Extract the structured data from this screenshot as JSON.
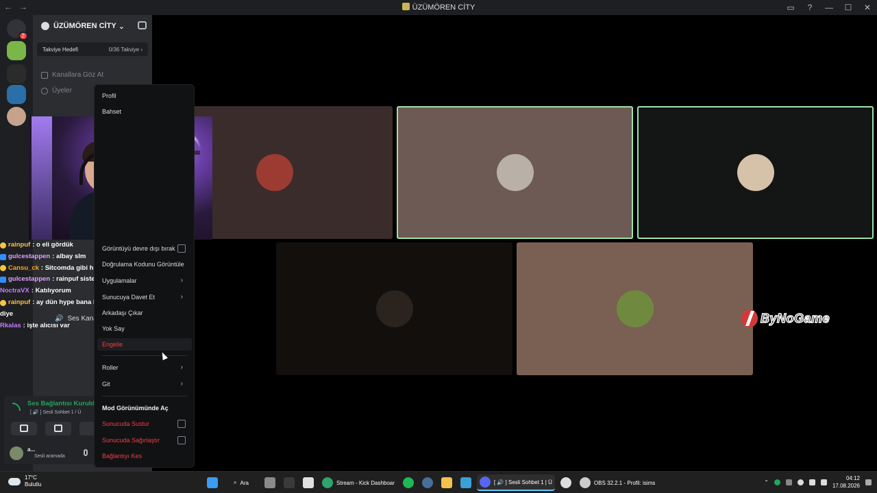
{
  "window": {
    "title": "ÜZÜMÖREN CİTY",
    "back": "←",
    "forward": "→",
    "controls": [
      "▭",
      "?",
      "—",
      "☐",
      "✕"
    ]
  },
  "rail": {
    "servers": [
      {
        "icon": "discord-home-icon",
        "badge": "2",
        "color": "#313338"
      },
      {
        "icon": "server-green-icon",
        "badge": "",
        "color": "#7ab648"
      },
      {
        "icon": "server-dark-icon",
        "badge": "",
        "color": "#2b2b2b"
      },
      {
        "icon": "server-tokat-icon",
        "badge": "",
        "color": "#2a6fa8"
      },
      {
        "icon": "server-avatar-icon",
        "badge": "",
        "color": "#c7a38c"
      }
    ]
  },
  "sidebar": {
    "server_name": "ÜZÜMÖREN CİTY",
    "chevron": "⌄",
    "boost_label": "Takviye Hedefi",
    "boost_value": "0/36 Takviye ›",
    "browse_channels": "Kanallara Göz At",
    "members": "Üyeler",
    "voice_button": "Ses Kana"
  },
  "chat": [
    {
      "user": "rainpuf",
      "text": ": o eli gördük",
      "color": "#f5c542",
      "icon_color": "#f5c542"
    },
    {
      "user": "gulcestappen",
      "text": ": albay slm",
      "color": "#e0a0ff",
      "icon_color": "#2f8fff"
    },
    {
      "user": "Cansu_ck",
      "text": ": Sitcomda gibi hissettim",
      "color": "#f5a623",
      "icon_color": "#f5c542"
    },
    {
      "user": "gulcestappen",
      "text": ": rainpuf sistematik linç yiyo",
      "color": "#e0a0ff",
      "icon_color": "#2f8fff"
    },
    {
      "user": "NoctraVX",
      "text": ": Katılıyorum",
      "color": "#c77dff",
      "icon_color": ""
    },
    {
      "user": "rainpuf",
      "text": ": ay dün hype bana kızdı bundan bahsettm",
      "color": "#f5c542",
      "icon_color": "#f5c542"
    },
    {
      "user": "",
      "text": "diye",
      "color": "#ffffff",
      "icon_color": ""
    },
    {
      "user": "Rkalas",
      "text": ": işte alıcısı var",
      "color": "#c77dff",
      "icon_color": ""
    }
  ],
  "voice_panel": {
    "status": "Ses Bağlantısı Kuruld",
    "channel": "[ 🔊 ] Sesli Sohbet 1 / Ü",
    "user_name": "a...",
    "user_status": "Sesli aramada"
  },
  "tiles": [
    {
      "bg": "#3a2c2a",
      "avatar": "#9c3b32",
      "speaking": false
    },
    {
      "bg": "#6e5a54",
      "avatar": "#b9b0a8",
      "speaking": true
    },
    {
      "bg": "#141515",
      "avatar": "#d6c2a8",
      "speaking": true
    },
    {
      "bg": "#120f0c",
      "avatar": "#2b231d",
      "speaking": false
    },
    {
      "bg": "#7a6052",
      "avatar": "#6f8a3e",
      "speaking": false
    }
  ],
  "watermark": "ByNoGame",
  "context_menu": {
    "items": [
      {
        "label": "Profil",
        "type": "normal"
      },
      {
        "label": "Bahset",
        "type": "normal"
      },
      {
        "label": "Görüntüyü devre dışı bırak",
        "type": "checkbox"
      },
      {
        "label": "Doğrulama Kodunu Görüntüle",
        "type": "normal"
      },
      {
        "label": "Uygulamalar",
        "type": "submenu"
      },
      {
        "label": "Sunucuya Davet Et",
        "type": "submenu"
      },
      {
        "label": "Arkadaşı Çıkar",
        "type": "normal"
      },
      {
        "label": "Yok Say",
        "type": "normal"
      },
      {
        "label": "Engelle",
        "type": "danger"
      },
      {
        "label": "Roller",
        "type": "submenu"
      },
      {
        "label": "Git",
        "type": "submenu"
      },
      {
        "label": "Mod Görünümünde Aç",
        "type": "bold"
      },
      {
        "label": "Sunucuda Sustur",
        "type": "danger-checkbox"
      },
      {
        "label": "Sunucuda Sağırlaştır",
        "type": "danger-checkbox"
      },
      {
        "label": "Bağlantıyı Kes",
        "type": "danger"
      }
    ]
  },
  "taskbar": {
    "weather_temp": "17°C",
    "weather_desc": "Bulutlu",
    "search": "Ara",
    "apps": [
      {
        "label": "",
        "icon": "windows-start-icon",
        "color": "#3a9cf3"
      },
      {
        "label": "Ara",
        "icon": "search-icon",
        "color": ""
      },
      {
        "label": "",
        "icon": "task-view-icon",
        "color": "#8a8a8a"
      },
      {
        "label": "",
        "icon": "epic-games-icon",
        "color": "#3a3a3a"
      },
      {
        "label": "",
        "icon": "store-icon",
        "color": "#e0e0e0"
      },
      {
        "label": "Stream - Kick Dashboar",
        "icon": "edge-icon",
        "color": "#2ea56a"
      },
      {
        "label": "",
        "icon": "spotify-icon",
        "color": "#1db954"
      },
      {
        "label": "",
        "icon": "steam-icon",
        "color": "#4a6e9a"
      },
      {
        "label": "",
        "icon": "folder-icon",
        "color": "#f2c14e"
      },
      {
        "label": "",
        "icon": "remote-icon",
        "color": "#3aa0d8"
      },
      {
        "label": "[ 🔊 ] Sesli Sohbet 1 | Ü",
        "icon": "discord-icon",
        "color": "#5865f2"
      },
      {
        "label": "",
        "icon": "app-icon",
        "color": "#dddddd"
      },
      {
        "label": "OBS 32.2.1 - Profil: isims",
        "icon": "obs-icon",
        "color": "#cccccc"
      }
    ],
    "time": "04:12",
    "date": "17.08.2026"
  }
}
